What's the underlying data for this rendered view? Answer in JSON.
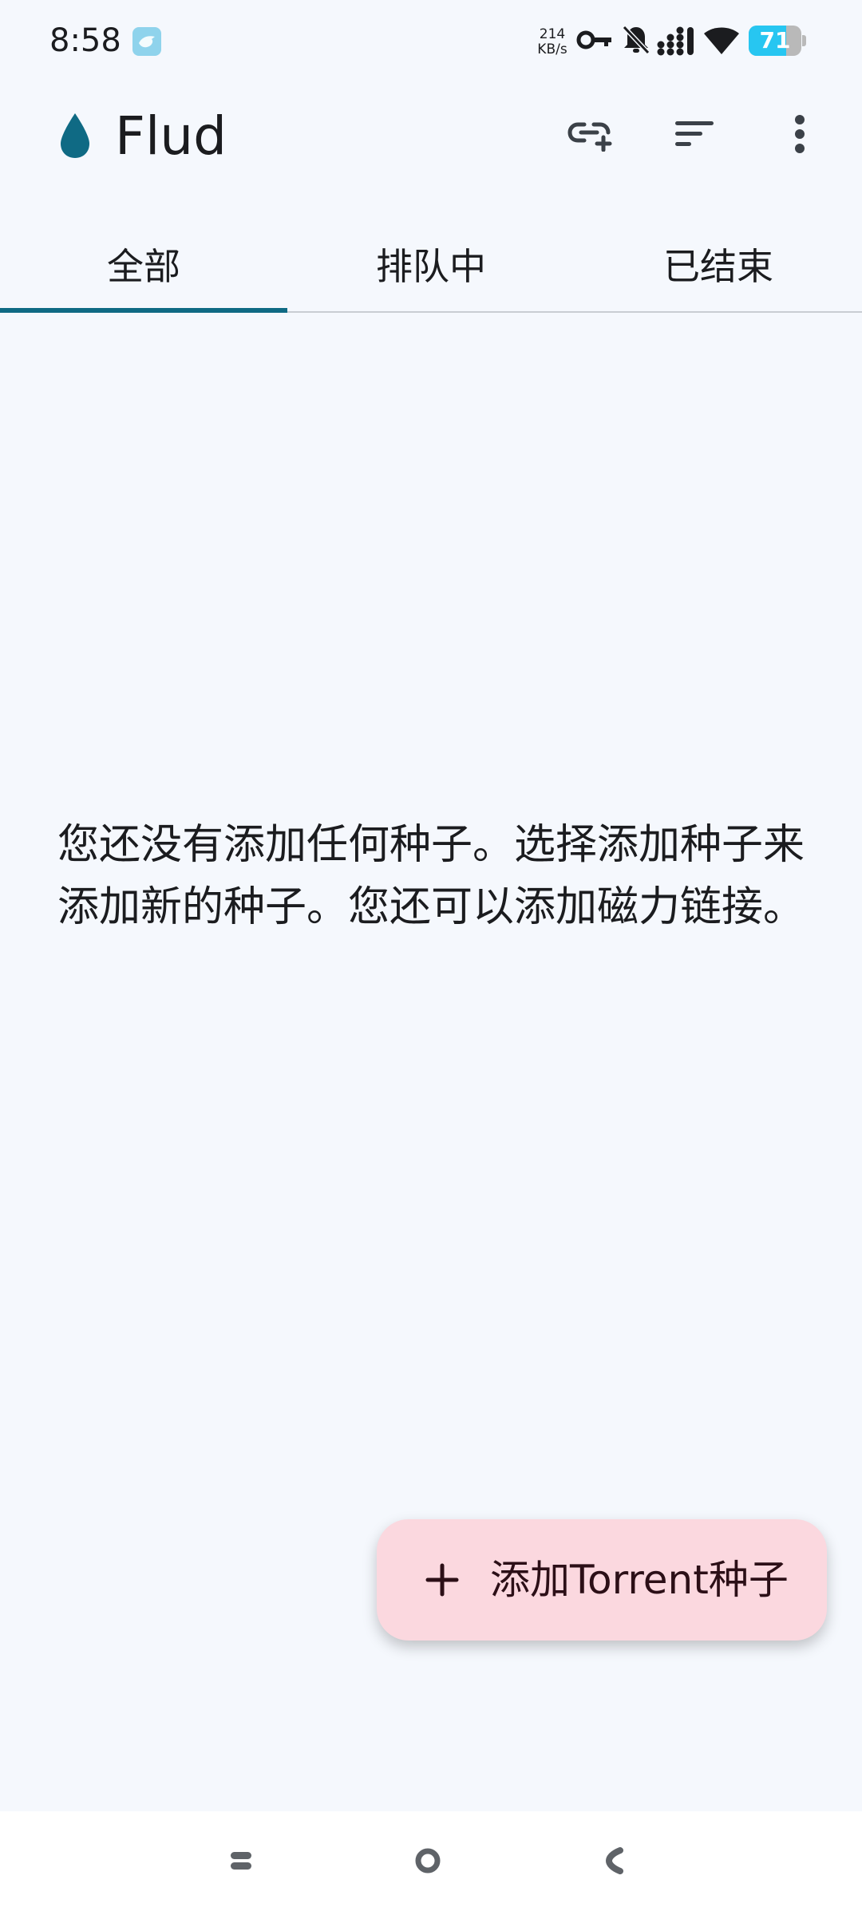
{
  "status_bar": {
    "time": "8:58",
    "app_icon": "bird-notification-icon",
    "net_speed_value": "214",
    "net_speed_unit": "KB/s",
    "icons": [
      "vpn-key-icon",
      "bell-muted-icon",
      "signal-icon",
      "wifi-icon"
    ],
    "battery_level": "71",
    "battery_fraction": 0.71,
    "battery_color": "#27c6f1"
  },
  "app_bar": {
    "logo": "water-drop-icon",
    "title": "Flud",
    "actions": [
      "add-link-icon",
      "sort-icon",
      "more-vert-icon"
    ]
  },
  "tabs": [
    {
      "label": "全部",
      "selected": true
    },
    {
      "label": "排队中",
      "selected": false
    },
    {
      "label": "已结束",
      "selected": false
    }
  ],
  "empty_state": {
    "message": "您还没有添加任何种子。选择添加种子来添加新的种子。您还可以添加磁力链接。"
  },
  "fab": {
    "icon": "plus-icon",
    "label": "添加Torrent种子"
  },
  "nav_bar": {
    "buttons": [
      "recents-icon",
      "home-icon",
      "back-icon"
    ]
  },
  "colors": {
    "background": "#f5f8fd",
    "accent": "#0f6a84",
    "fab_background": "#fbd8df",
    "text": "#1b1c1f"
  }
}
